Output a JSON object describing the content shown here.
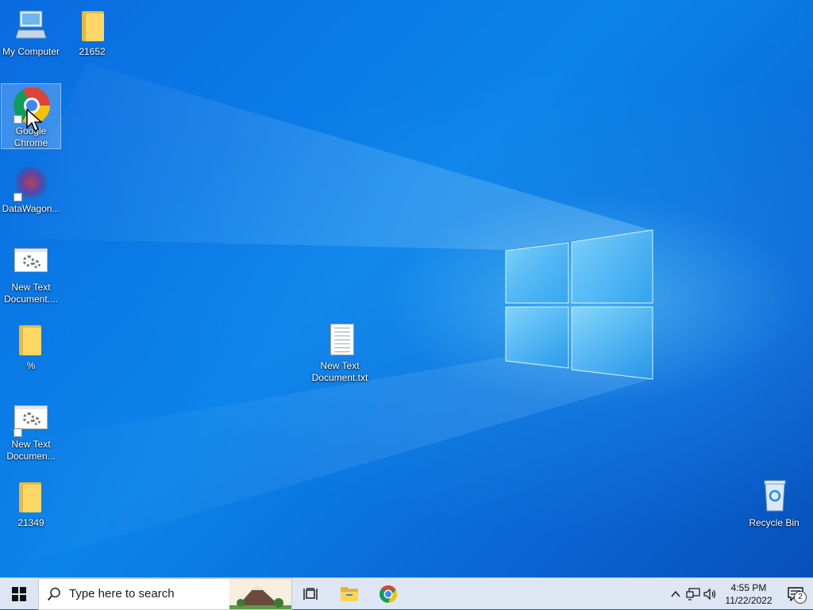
{
  "desktop": {
    "icons": [
      {
        "label": "My Computer"
      },
      {
        "label": "21652"
      },
      {
        "label": "Google\nChrome"
      },
      {
        "label": "DataWagon..."
      },
      {
        "label": "New Text\nDocument...."
      },
      {
        "label": "%"
      },
      {
        "label": "New Text\nDocumen..."
      },
      {
        "label": "21349"
      },
      {
        "label": "New Text\nDocument.txt"
      },
      {
        "label": "Recycle Bin"
      }
    ]
  },
  "taskbar": {
    "search_placeholder": "Type here to search",
    "pinned": [
      "task-view-icon",
      "file-explorer-icon",
      "chrome-icon"
    ],
    "clock_time": "4:55 PM",
    "clock_date": "11/22/2022",
    "notification_count": "2"
  },
  "colors": {
    "desktop_blue": "#0a6be0",
    "taskbar": "#dde6f2",
    "selection": "#b4d7ff"
  }
}
